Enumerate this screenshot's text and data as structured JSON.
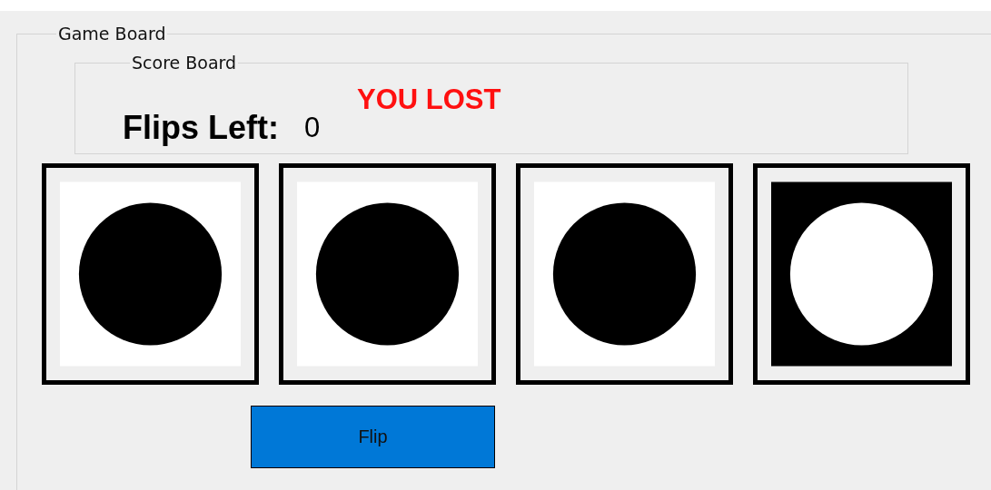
{
  "game_board": {
    "title": "Game Board",
    "score_board": {
      "title": "Score Board",
      "message": "YOU LOST",
      "flips_label": "Flips Left:",
      "flips_value": "0"
    },
    "cards": [
      {
        "kind": "dark"
      },
      {
        "kind": "dark"
      },
      {
        "kind": "dark"
      },
      {
        "kind": "light"
      }
    ],
    "flip_button": "Flip"
  }
}
